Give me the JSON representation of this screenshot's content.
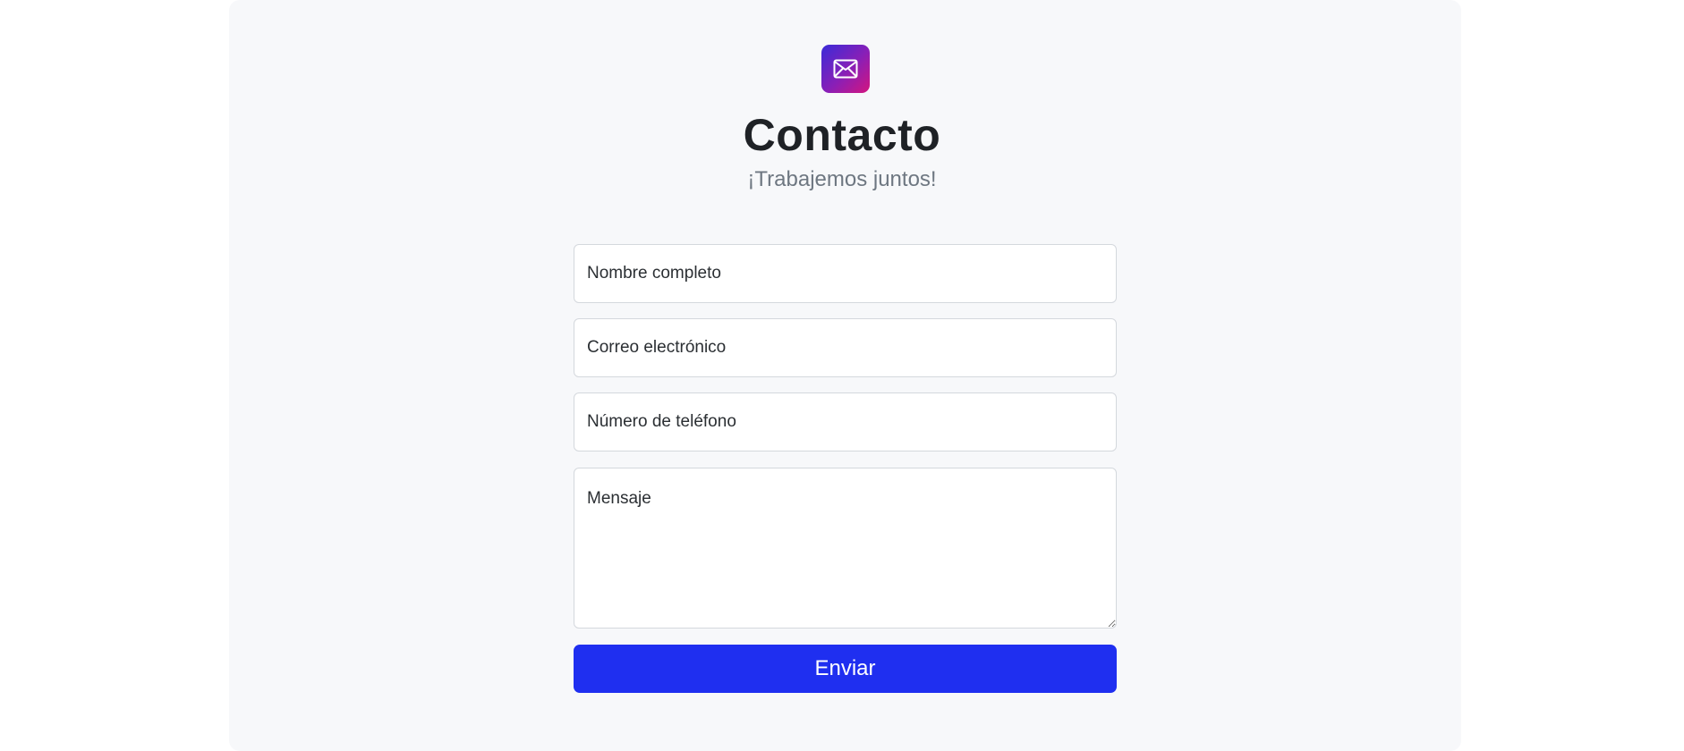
{
  "header": {
    "icon": "envelope-icon",
    "title": "Contacto",
    "subtitle": "¡Trabajemos juntos!"
  },
  "form": {
    "name_placeholder": "Nombre completo",
    "email_placeholder": "Correo electrónico",
    "phone_placeholder": "Número de teléfono",
    "message_placeholder": "Mensaje",
    "submit_label": "Enviar"
  },
  "colors": {
    "accent": "#1f2ff0",
    "panel_background": "#f7f8fa",
    "title_text": "#1f2226",
    "subtitle_text": "#6e7781"
  }
}
